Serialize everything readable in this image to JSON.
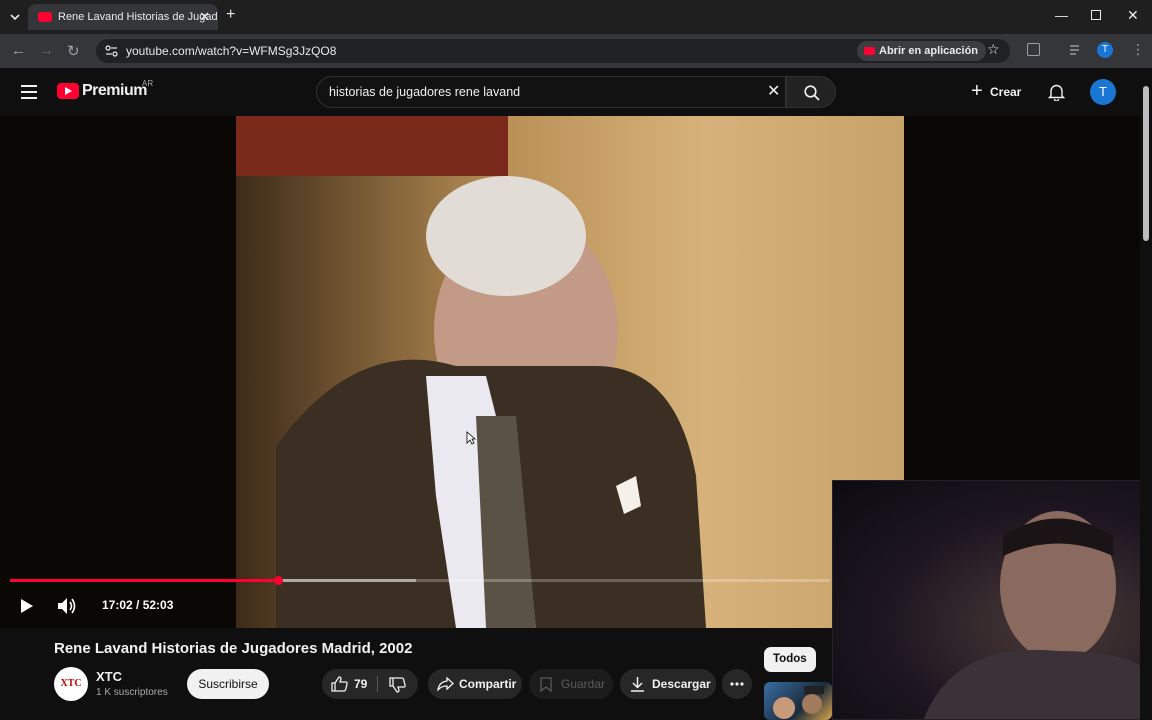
{
  "browser": {
    "tab_title": "Rene Lavand Historias de Jugadores",
    "url": "youtube.com/watch?v=WFMSg3JzQO8",
    "open_in_app": "Abrir en aplicación",
    "profile_initial": "T"
  },
  "youtube": {
    "logo_text": "Premium",
    "region": "AR",
    "search_value": "historias de jugadores rene lavand",
    "create_label": "Crear",
    "avatar_initial": "T"
  },
  "player": {
    "time": "17:02 / 52:03",
    "progress_fraction": 0.3271,
    "buffered_fraction": 0.495
  },
  "video": {
    "title": "Rene Lavand Historias de Jugadores Madrid, 2002",
    "channel_logo_text": "XTC",
    "channel": "XTC",
    "subscribers": "1 K suscriptores",
    "subscribe_label": "Suscribirse",
    "likes": "79",
    "share_label": "Compartir",
    "save_label": "Guardar",
    "download_label": "Descargar"
  },
  "sidebar": {
    "chip_all": "Todos"
  },
  "colors": {
    "accent": "#ff0033",
    "background": "#0f0f0f",
    "avatar": "#1976d2"
  }
}
